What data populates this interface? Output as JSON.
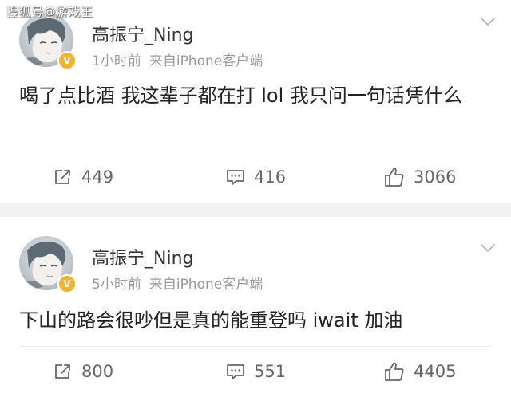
{
  "watermark": "搜狐号@游戏王",
  "posts": [
    {
      "username": "高振宁_Ning",
      "time": "1小时前",
      "source": "来自iPhone客户端",
      "content": "喝了点比酒 我这辈子都在打 lol  我只问一句话凭什么",
      "reposts": "449",
      "comments": "416",
      "likes": "3066"
    },
    {
      "username": "高振宁_Ning",
      "time": "5小时前",
      "source": "来自iPhone客户端",
      "content": "下山的路会很吵但是真的能重登吗 iwait  加油",
      "reposts": "800",
      "comments": "551",
      "likes": "4405"
    }
  ],
  "icons": {
    "verified": "verified-badge-icon",
    "menu": "chevron-down-icon",
    "repost": "repost-icon",
    "comment": "comment-icon",
    "like": "like-icon"
  },
  "colors": {
    "text": "#222222",
    "meta": "#9a9a9a",
    "verified": "#f2b32d",
    "separator": "#f2f2f2"
  }
}
